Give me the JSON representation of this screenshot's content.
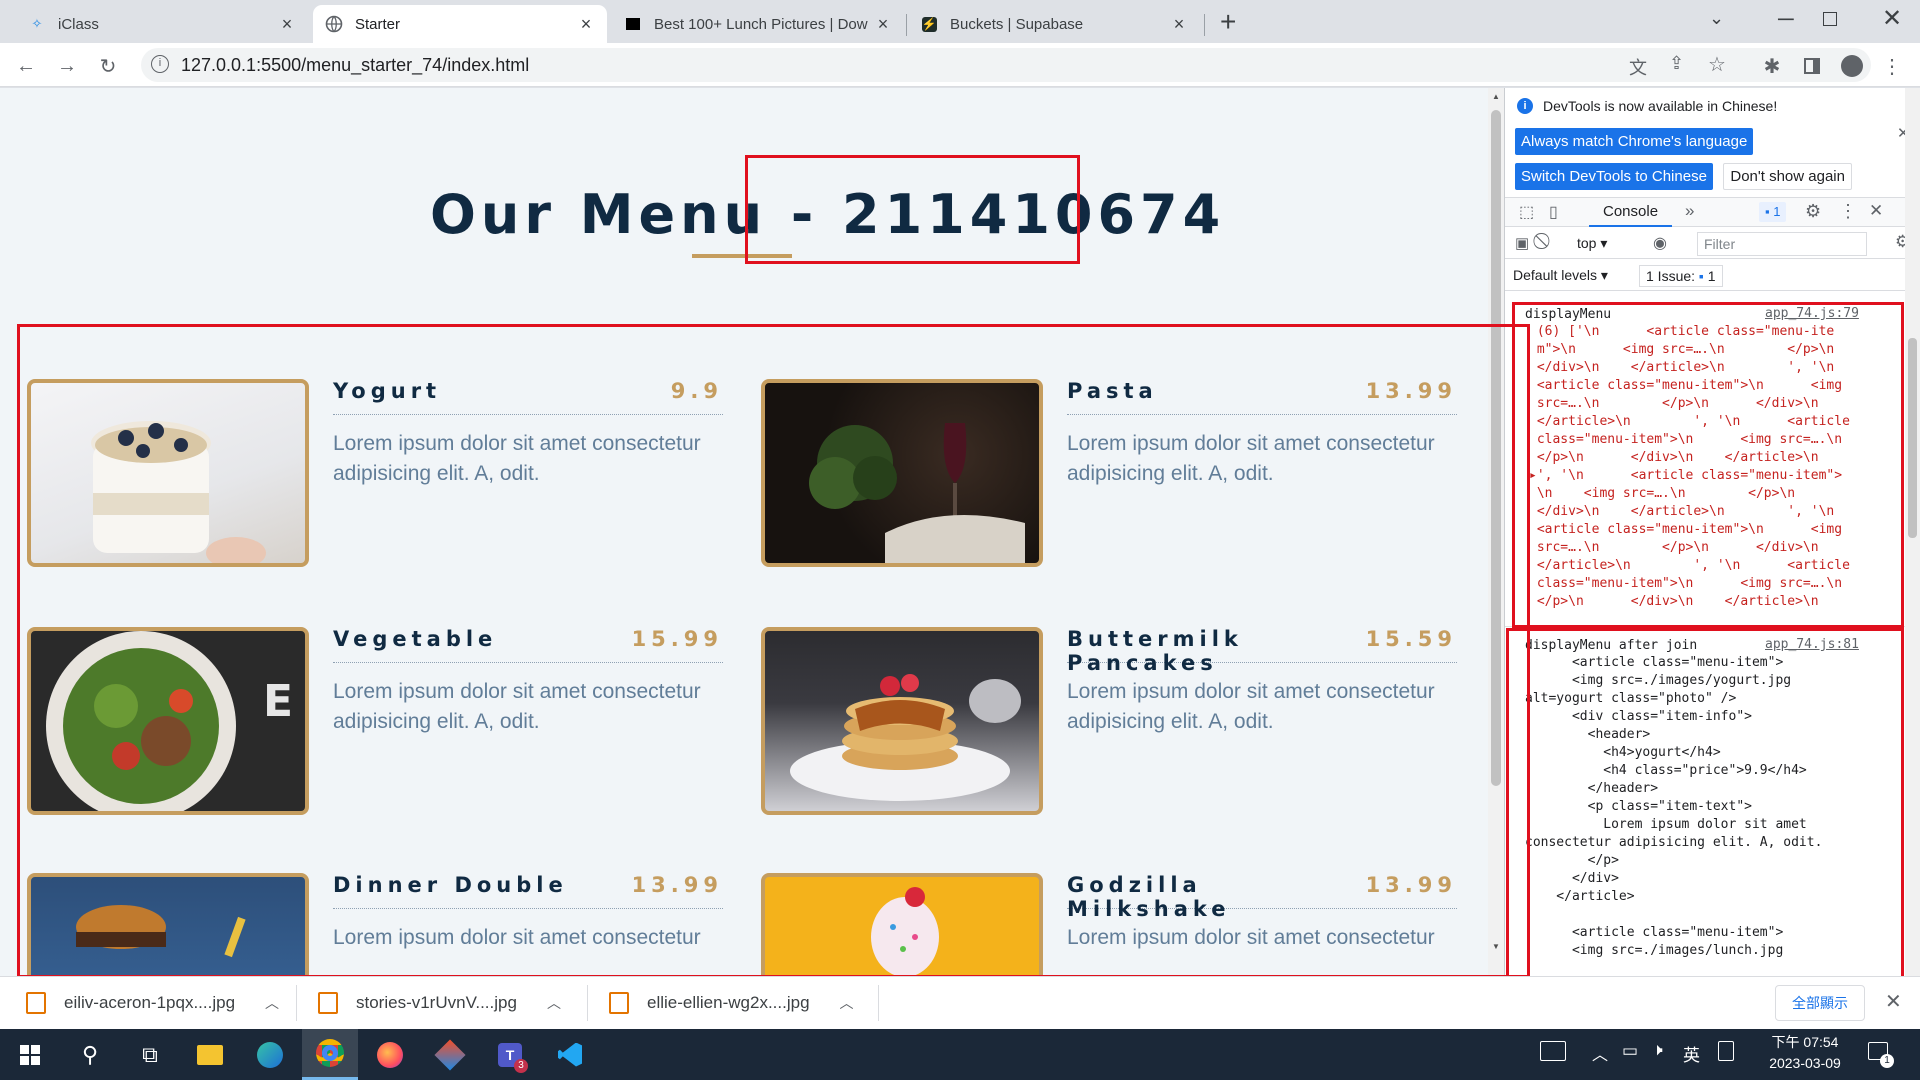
{
  "browser": {
    "tabs": [
      {
        "title": "iClass",
        "icon": "iclass-logo-icon",
        "active": false
      },
      {
        "title": "Starter",
        "icon": "globe-icon",
        "active": true
      },
      {
        "title": "Best 100+ Lunch Pictures | Dow",
        "icon": "unsplash-logo-icon",
        "active": false
      },
      {
        "title": "Buckets | Supabase",
        "icon": "supabase-logo-icon",
        "active": false
      }
    ],
    "new_tab": "+",
    "url": "127.0.0.1:5500/menu_starter_74/index.html"
  },
  "page": {
    "title": "Our Menu - 211410674",
    "items": [
      {
        "name": "Yogurt",
        "price": "9.9",
        "text": "Lorem ipsum dolor sit amet consectetur adipisicing elit. A, odit."
      },
      {
        "name": "Pasta",
        "price": "13.99",
        "text": "Lorem ipsum dolor sit amet consectetur adipisicing elit. A, odit."
      },
      {
        "name": "Vegetable",
        "price": "15.99",
        "text": "Lorem ipsum dolor sit amet consectetur adipisicing elit. A, odit."
      },
      {
        "name": "Buttermilk Pancakes",
        "price": "15.59",
        "text": "Lorem ipsum dolor sit amet consectetur adipisicing elit. A, odit."
      },
      {
        "name": "Dinner Double",
        "price": "13.99",
        "text": "Lorem ipsum dolor sit amet consectetur"
      },
      {
        "name": "Godzilla Milkshake",
        "price": "13.99",
        "text": "Lorem ipsum dolor sit amet consectetur"
      }
    ]
  },
  "devtools": {
    "banner": "DevTools is now available in Chinese!",
    "btn_match": "Always match Chrome's language",
    "btn_switch": "Switch DevTools to Chinese",
    "btn_dont_show": "Don't show again",
    "tab_console": "Console",
    "more_tabs": "»",
    "issues_badge": "1",
    "context": "top",
    "filter_placeholder": "Filter",
    "levels": "Default levels",
    "issues": "1 Issue:",
    "issues_count": "1",
    "log1_label": "displayMenu",
    "log1_source": "app_74.js:79",
    "log1_body": " (6) ['\\n      <article class=\"menu-ite\n m\">\\n      <img src=….\\n        </p>\\n\n </div>\\n    </article>\\n        ', '\\n\n <article class=\"menu-item\">\\n      <img\n src=….\\n        </p>\\n      </div>\\n\n </article>\\n        ', '\\n      <article\n class=\"menu-item\">\\n      <img src=….\\n\n </p>\\n      </div>\\n    </article>\\n\n▸', '\\n      <article class=\"menu-item\">\n \\n    <img src=….\\n        </p>\\n\n </div>\\n    </article>\\n        ', '\\n\n <article class=\"menu-item\">\\n      <img\n src=….\\n        </p>\\n      </div>\\n\n </article>\\n        ', '\\n      <article\n class=\"menu-item\">\\n      <img src=….\\n\n </p>\\n      </div>\\n    </article>\\n\n ']",
    "log2_label": "displayMenu after join",
    "log2_source": "app_74.js:81",
    "log2_body": "      <article class=\"menu-item\">\n      <img src=./images/yogurt.jpg\nalt=yogurt class=\"photo\" />\n      <div class=\"item-info\">\n        <header>\n          <h4>yogurt</h4>\n          <h4 class=\"price\">9.9</h4>\n        </header>\n        <p class=\"item-text\">\n          Lorem ipsum dolor sit amet\nconsectetur adipisicing elit. A, odit.\n        </p>\n      </div>\n    </article>\n\n      <article class=\"menu-item\">\n      <img src=./images/lunch.jpg"
  },
  "downloads": {
    "files": [
      "eiliv-aceron-1pqx....jpg",
      "stories-v1rUvnV....jpg",
      "ellie-ellien-wg2x....jpg"
    ],
    "show_all": "全部顯示"
  },
  "taskbar": {
    "time": "下午 07:54",
    "date": "2023-03-09",
    "ime": "英",
    "teams_badge": "3",
    "notify_badge": "1"
  },
  "colors": {
    "accent": "#c59d5f",
    "title": "#102a42",
    "annotation": "#e0101e",
    "devtools_blue": "#1a73e8"
  }
}
